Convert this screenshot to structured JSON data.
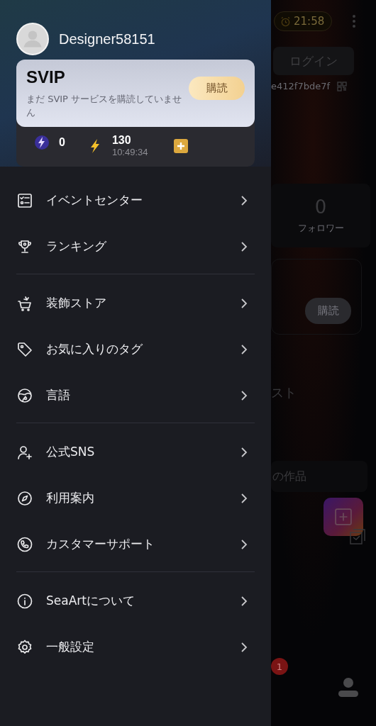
{
  "drawer": {
    "user": {
      "name": "Designer58151"
    },
    "svip": {
      "title": "SVIP",
      "message": "まだ SVIP サービスを購読していません",
      "button": "購読"
    },
    "stats": [
      {
        "kind": "crystal",
        "value": "0"
      },
      {
        "kind": "energy",
        "value": "130",
        "time": "10:49:34"
      }
    ],
    "menu_groups": [
      [
        {
          "label": "イベントセンター"
        },
        {
          "label": "ランキング"
        }
      ],
      [
        {
          "label": "装飾ストア"
        },
        {
          "label": "お気に入りのタグ"
        },
        {
          "label": "言語"
        }
      ],
      [
        {
          "label": "公式SNS"
        },
        {
          "label": "利用案内"
        },
        {
          "label": "カスタマーサポート"
        }
      ],
      [
        {
          "label": "SeaArtについて"
        },
        {
          "label": "一般設定"
        }
      ]
    ]
  },
  "background": {
    "timer": "21:58",
    "login_button": "ログイン",
    "user_id": "e412f7bde7f",
    "follower_count": "0",
    "follower_label": "フォロワー",
    "subscribe_button": "購読",
    "section_text": "スト",
    "works_tab": "の作品",
    "notification_badge": "1"
  }
}
